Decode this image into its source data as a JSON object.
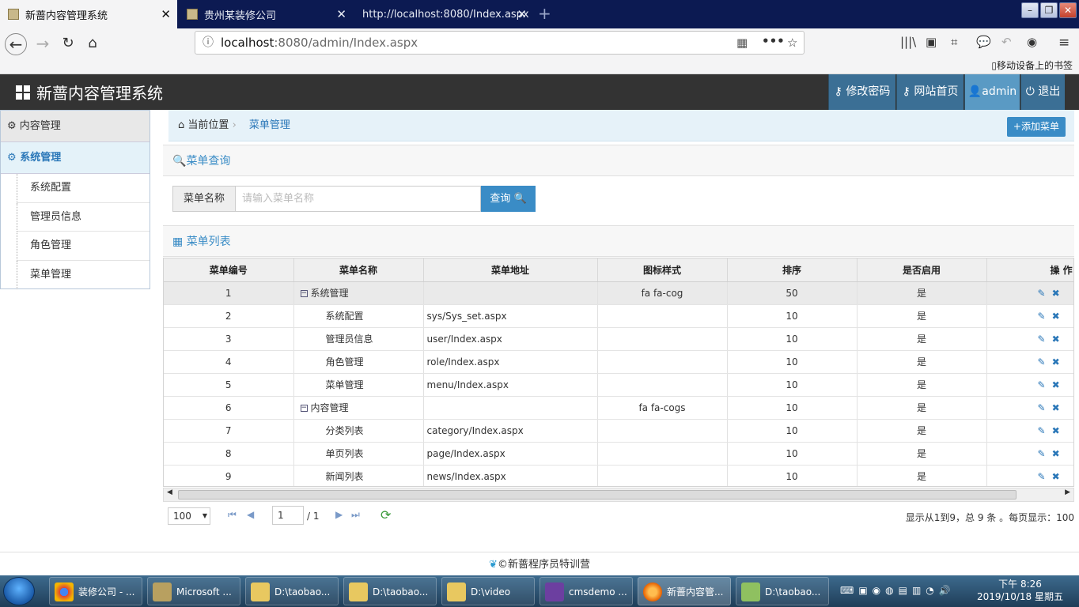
{
  "browser": {
    "tabs": [
      {
        "title": "新蔷内容管理系统",
        "active": true
      },
      {
        "title": "贵州某装修公司",
        "active": false
      },
      {
        "title": "http://localhost:8080/Index.aspx",
        "active": false
      }
    ],
    "url_host": "localhost",
    "url_path": ":8080/admin/Index.aspx",
    "bookmark_note": "移动设备上的书签"
  },
  "header": {
    "title": "新蔷内容管理系统",
    "buttons": {
      "change_password": "修改密码",
      "site_home": "网站首页",
      "user": "admin",
      "logout": "退出"
    }
  },
  "sidebar": {
    "group1": "内容管理",
    "group2": "系统管理",
    "items": [
      "系统配置",
      "管理员信息",
      "角色管理",
      "菜单管理"
    ]
  },
  "breadcrumb": {
    "location": "当前位置",
    "current": "菜单管理",
    "add_button": "添加菜单"
  },
  "query": {
    "title": "菜单查询",
    "label": "菜单名称",
    "placeholder": "请输入菜单名称",
    "button": "查询"
  },
  "list": {
    "title": "菜单列表",
    "columns": [
      "菜单编号",
      "菜单名称",
      "菜单地址",
      "图标样式",
      "排序",
      "是否启用",
      "操 作"
    ],
    "rows": [
      {
        "id": "1",
        "name": "系统管理",
        "url": "",
        "icon": "fa fa-cog",
        "sort": "50",
        "enabled": "是",
        "parent": true
      },
      {
        "id": "2",
        "name": "系统配置",
        "url": "sys/Sys_set.aspx",
        "icon": "",
        "sort": "10",
        "enabled": "是",
        "parent": false
      },
      {
        "id": "3",
        "name": "管理员信息",
        "url": "user/Index.aspx",
        "icon": "",
        "sort": "10",
        "enabled": "是",
        "parent": false
      },
      {
        "id": "4",
        "name": "角色管理",
        "url": "role/Index.aspx",
        "icon": "",
        "sort": "10",
        "enabled": "是",
        "parent": false
      },
      {
        "id": "5",
        "name": "菜单管理",
        "url": "menu/Index.aspx",
        "icon": "",
        "sort": "10",
        "enabled": "是",
        "parent": false
      },
      {
        "id": "6",
        "name": "内容管理",
        "url": "",
        "icon": "fa fa-cogs",
        "sort": "10",
        "enabled": "是",
        "parent": true
      },
      {
        "id": "7",
        "name": "分类列表",
        "url": "category/Index.aspx",
        "icon": "",
        "sort": "10",
        "enabled": "是",
        "parent": false
      },
      {
        "id": "8",
        "name": "单页列表",
        "url": "page/Index.aspx",
        "icon": "",
        "sort": "10",
        "enabled": "是",
        "parent": false
      },
      {
        "id": "9",
        "name": "新闻列表",
        "url": "news/Index.aspx",
        "icon": "",
        "sort": "10",
        "enabled": "是",
        "parent": false
      }
    ]
  },
  "pager": {
    "page_size": "100",
    "page": "1",
    "total_pages": "/ 1",
    "summary": "显示从1到9，总 9 条 。每页显示：100"
  },
  "footer": {
    "text": "©新蔷程序员特训营"
  },
  "taskbar": {
    "items": [
      "装修公司 - ...",
      "Microsoft ...",
      "D:\\taobao...",
      "D:\\taobao...",
      "D:\\video",
      "cmsdemo ...",
      "新蔷内容管...",
      "D:\\taobao..."
    ],
    "time": "下午 8:26",
    "date": "2019/10/18 星期五"
  },
  "colors": {
    "accent": "#3a8cc6",
    "header_bg": "#333333",
    "header_btn": "#3b6f95"
  }
}
